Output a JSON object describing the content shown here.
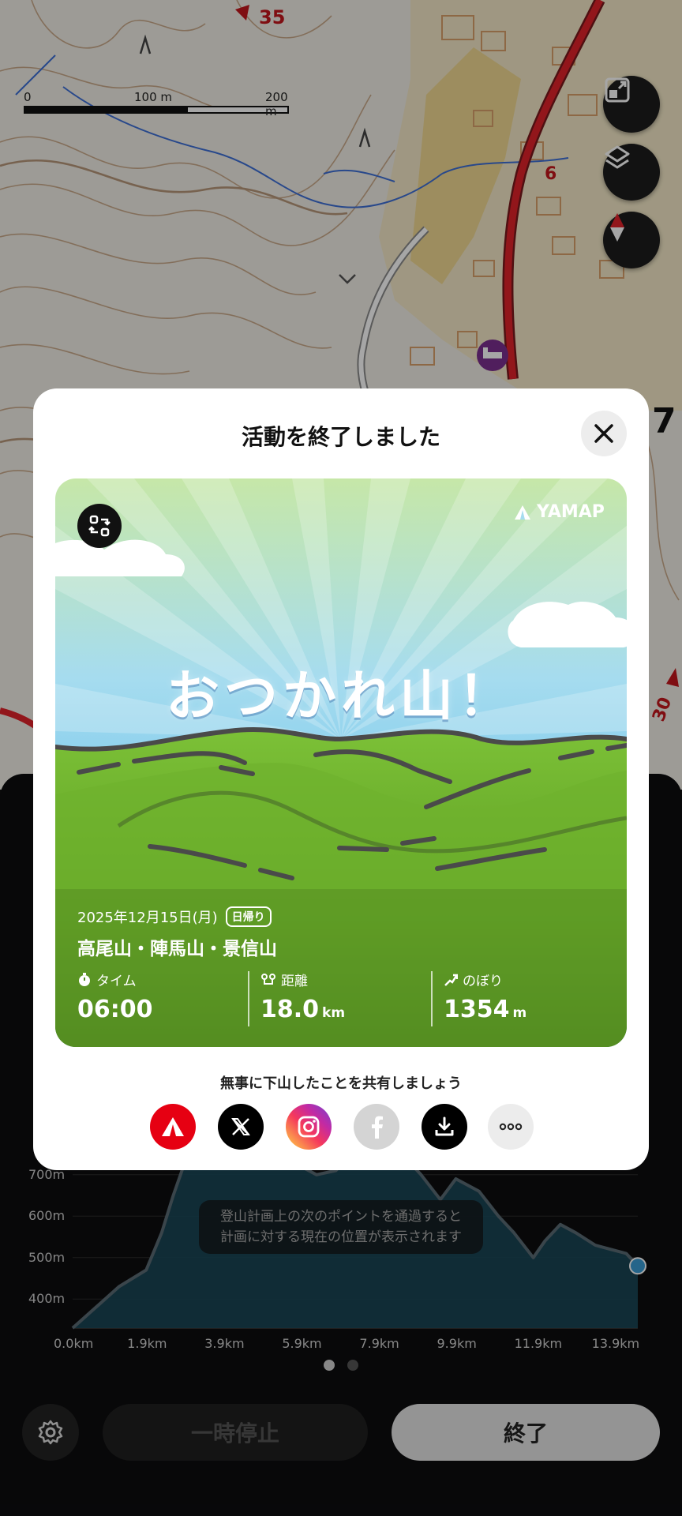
{
  "map": {
    "scale_labels": [
      "0",
      "100 m",
      "200 m"
    ],
    "labels": {
      "route_35": "35",
      "route_6": "6",
      "route_30": "30",
      "edge_number": "7"
    },
    "buttons": [
      "expand-icon",
      "layers-icon",
      "compass-icon"
    ]
  },
  "modal": {
    "title": "活動を終了しました",
    "card": {
      "brand": "YAMAP",
      "headline": "おつかれ山！",
      "date": "2025年12月15日(月)",
      "badge": "日帰り",
      "peaks": "高尾山・陣馬山・景信山",
      "stats": {
        "time_label": "タイム",
        "time_value": "06:00",
        "distance_label": "距離",
        "distance_value": "18.0",
        "distance_unit": "km",
        "ascent_label": "のぼり",
        "ascent_value": "1354",
        "ascent_unit": "m"
      }
    },
    "share_text": "無事に下山したことを共有しましょう",
    "share_buttons": [
      "yamap-icon",
      "x-icon",
      "instagram-icon",
      "facebook-icon",
      "download-icon",
      "more-icon"
    ]
  },
  "panel": {
    "hint_line1": "登山計画上の次のポイントを通過すると",
    "hint_line2": "計画に対する現在の位置が表示されます",
    "pause_label": "一時停止",
    "end_label": "終了"
  },
  "chart_data": {
    "type": "area",
    "x": [
      0.0,
      0.6,
      1.2,
      1.9,
      2.3,
      2.6,
      2.9,
      3.3,
      3.8,
      4.3,
      4.8,
      5.3,
      5.9,
      6.3,
      6.8,
      7.3,
      7.8,
      8.3,
      8.6,
      9.0,
      9.5,
      9.9,
      10.5,
      11.0,
      11.4,
      11.9,
      12.2,
      12.6,
      13.0,
      13.5,
      13.9,
      14.3,
      14.6
    ],
    "values": [
      330,
      380,
      430,
      470,
      560,
      650,
      730,
      760,
      790,
      770,
      740,
      730,
      720,
      700,
      710,
      760,
      730,
      760,
      740,
      700,
      640,
      690,
      660,
      600,
      560,
      500,
      540,
      580,
      560,
      530,
      520,
      510,
      480
    ],
    "xticks": [
      "0.0km",
      "1.9km",
      "3.9km",
      "5.9km",
      "7.9km",
      "9.9km",
      "11.9km",
      "13.9km"
    ],
    "yticks": [
      "700m",
      "600m",
      "500m",
      "400m"
    ],
    "xlim": [
      0,
      14.6
    ],
    "ylim": [
      330,
      810
    ],
    "series_color": "#5a6a73",
    "fill_color": "#1b4a5c",
    "current_point_color": "#3a9bd5",
    "pager": {
      "count": 2,
      "active": 0
    }
  },
  "colors": {
    "yamap_red": "#e60012",
    "card_green": "#4b8a1e",
    "sky_blue": "#8fd2f0"
  }
}
